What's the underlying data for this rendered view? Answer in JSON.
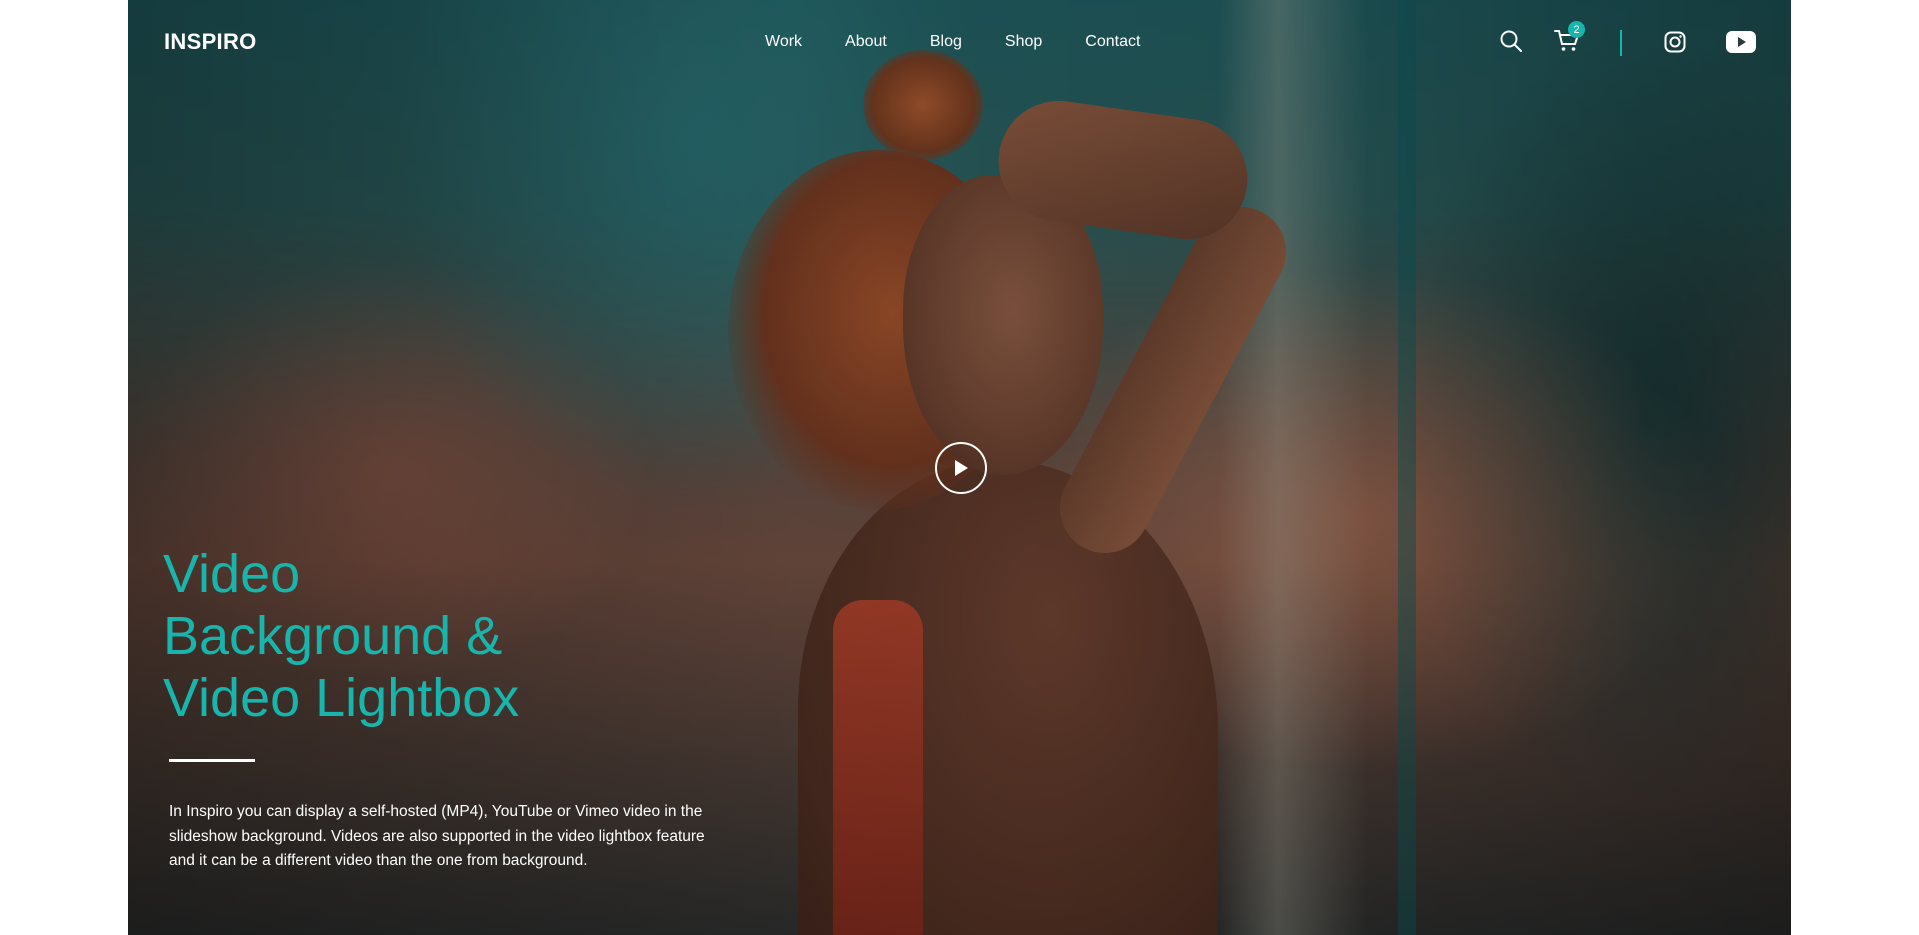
{
  "header": {
    "logo": "INSPIRO",
    "nav": [
      {
        "label": "Work"
      },
      {
        "label": "About"
      },
      {
        "label": "Blog"
      },
      {
        "label": "Shop"
      },
      {
        "label": "Contact"
      }
    ],
    "cart_count": "2",
    "icons": [
      "search-icon",
      "cart-icon",
      "instagram-icon",
      "youtube-icon"
    ]
  },
  "hero": {
    "title_lines": [
      "Video",
      "Background &",
      "Video Lightbox"
    ],
    "description": "In Inspiro you can display a self-hosted (MP4), YouTube or Vimeo video in the slideshow background. Videos are also supported in the video lightbox feature and it can be a different video than the one from background.",
    "play_icon": "play-icon"
  },
  "colors": {
    "accent": "#17b5ab",
    "text": "#ffffff"
  }
}
